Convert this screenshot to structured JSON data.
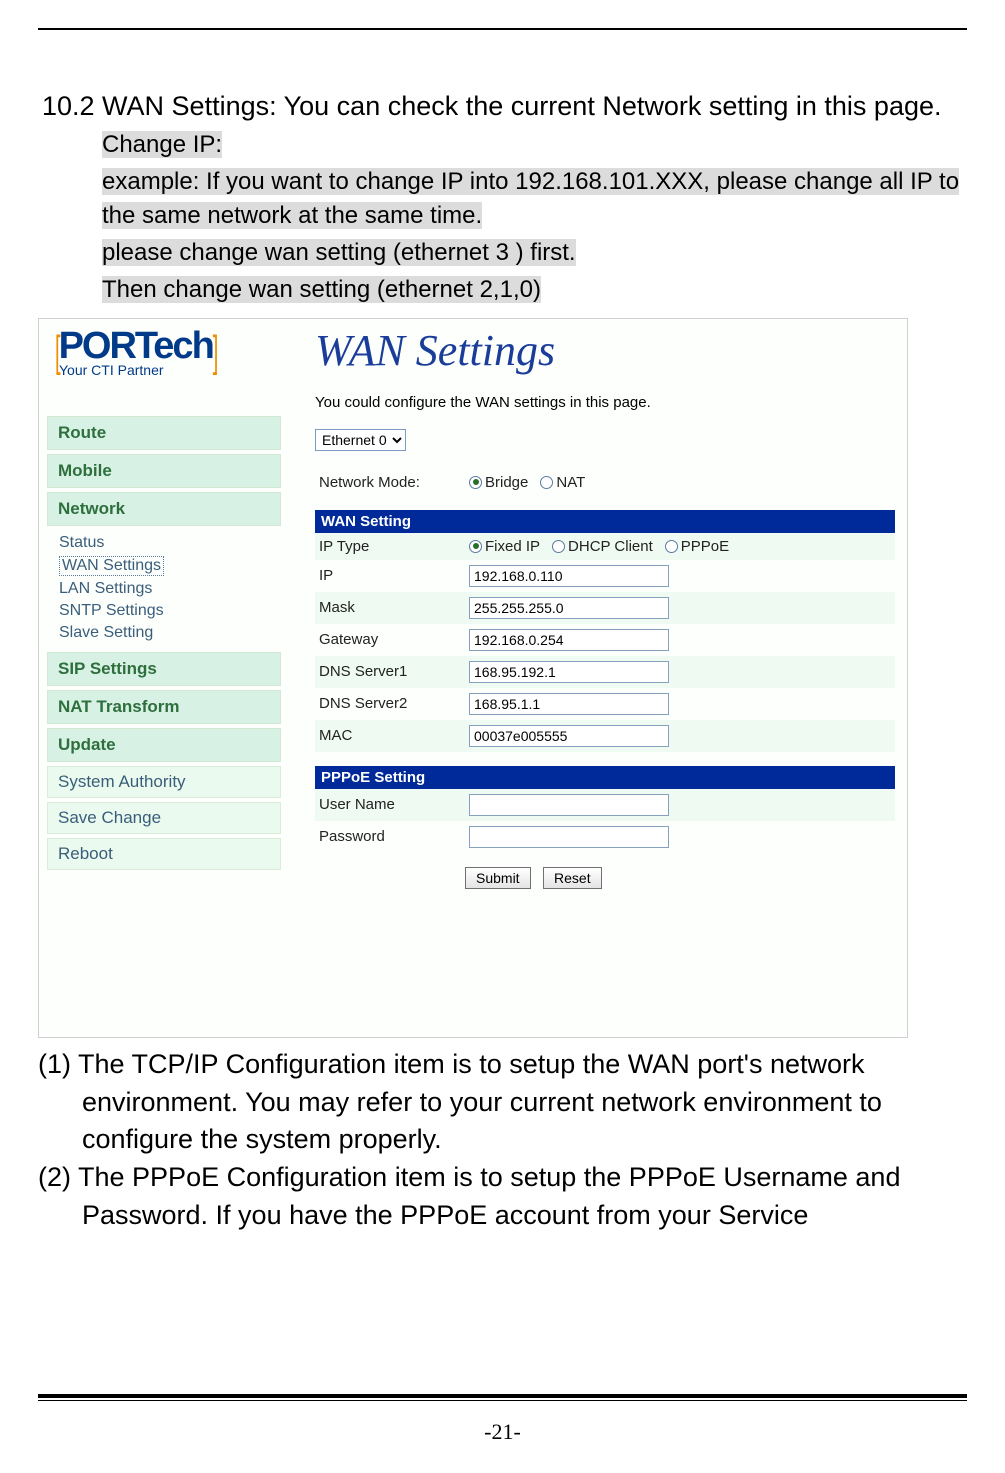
{
  "doc": {
    "section_title": "10.2 WAN Settings: You can check the current Network setting in this page.",
    "change_ip_label": "Change IP:",
    "change_ip_text": "example: If you want to change IP into 192.168.101.XXX, please change all IP to the same network at the same time.",
    "change_ip_step1": "please change wan setting (ethernet 3 ) first.",
    "change_ip_step2": "Then change wan setting (ethernet 2,1,0)",
    "para1": "(1) The TCP/IP Configuration item is to setup the WAN port's network environment. You may refer to your current network environment to configure the system properly.",
    "para2": "(2) The PPPoE Configuration item is to setup the PPPoE Username and Password. If you have the PPPoE account from your Service",
    "page_number": "-21-"
  },
  "logo": {
    "brand": "PORTech",
    "tagline": "Your CTI Partner"
  },
  "nav": {
    "route": "Route",
    "mobile": "Mobile",
    "network": "Network",
    "network_sub": {
      "status": "Status",
      "wan": "WAN Settings",
      "lan": "LAN Settings",
      "sntp": "SNTP Settings",
      "slave": "Slave Setting"
    },
    "sip": "SIP Settings",
    "nat": "NAT Transform",
    "update": "Update",
    "sysauth": "System Authority",
    "save": "Save Change",
    "reboot": "Reboot"
  },
  "main": {
    "title": "WAN Settings",
    "desc": "You could configure the WAN settings in this page.",
    "eth_selected": "Ethernet 0",
    "network_mode_label": "Network Mode:",
    "mode_bridge": "Bridge",
    "mode_nat": "NAT",
    "wan_setting_header": "WAN Setting",
    "ip_type_label": "IP Type",
    "ip_type_fixed": "Fixed IP",
    "ip_type_dhcp": "DHCP Client",
    "ip_type_pppoe": "PPPoE",
    "fields": {
      "ip_label": "IP",
      "ip_value": "192.168.0.110",
      "mask_label": "Mask",
      "mask_value": "255.255.255.0",
      "gw_label": "Gateway",
      "gw_value": "192.168.0.254",
      "dns1_label": "DNS Server1",
      "dns1_value": "168.95.192.1",
      "dns2_label": "DNS Server2",
      "dns2_value": "168.95.1.1",
      "mac_label": "MAC",
      "mac_value": "00037e005555"
    },
    "pppoe_header": "PPPoE Setting",
    "pppoe_user_label": "User Name",
    "pppoe_user_value": "",
    "pppoe_pass_label": "Password",
    "pppoe_pass_value": "",
    "submit_label": "Submit",
    "reset_label": "Reset"
  }
}
